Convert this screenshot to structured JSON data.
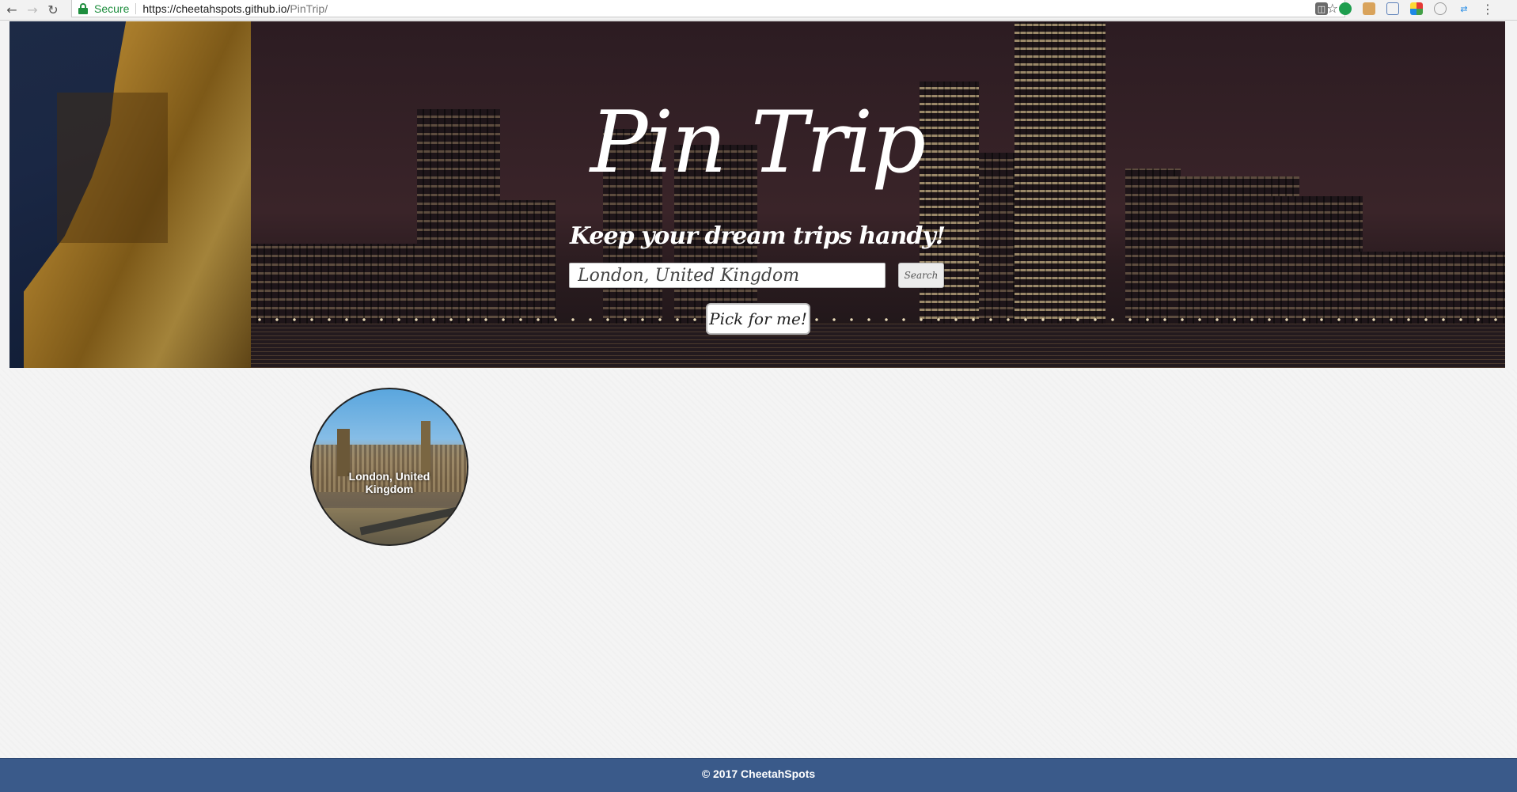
{
  "browser": {
    "secure_label": "Secure",
    "url_host": "https://cheetahspots.github.io/",
    "url_path": "PinTrip/",
    "icons": [
      "back-arrow-icon",
      "forward-arrow-icon",
      "reload-icon",
      "lock-icon",
      "star-icon",
      "menu-icon"
    ]
  },
  "hero": {
    "title": "Pin Trip",
    "subtitle": "Keep your dream trips handy!",
    "search_value": "London, United Kingdom",
    "search_button": "Search",
    "pick_button": "Pick for me!"
  },
  "pins": [
    {
      "label": "London, United Kingdom"
    }
  ],
  "footer": {
    "text": "© 2017 CheetahSpots"
  },
  "colors": {
    "footer": "#3a5a8a",
    "secure": "#1e8e3e",
    "page_background": "#f4f4f4"
  }
}
